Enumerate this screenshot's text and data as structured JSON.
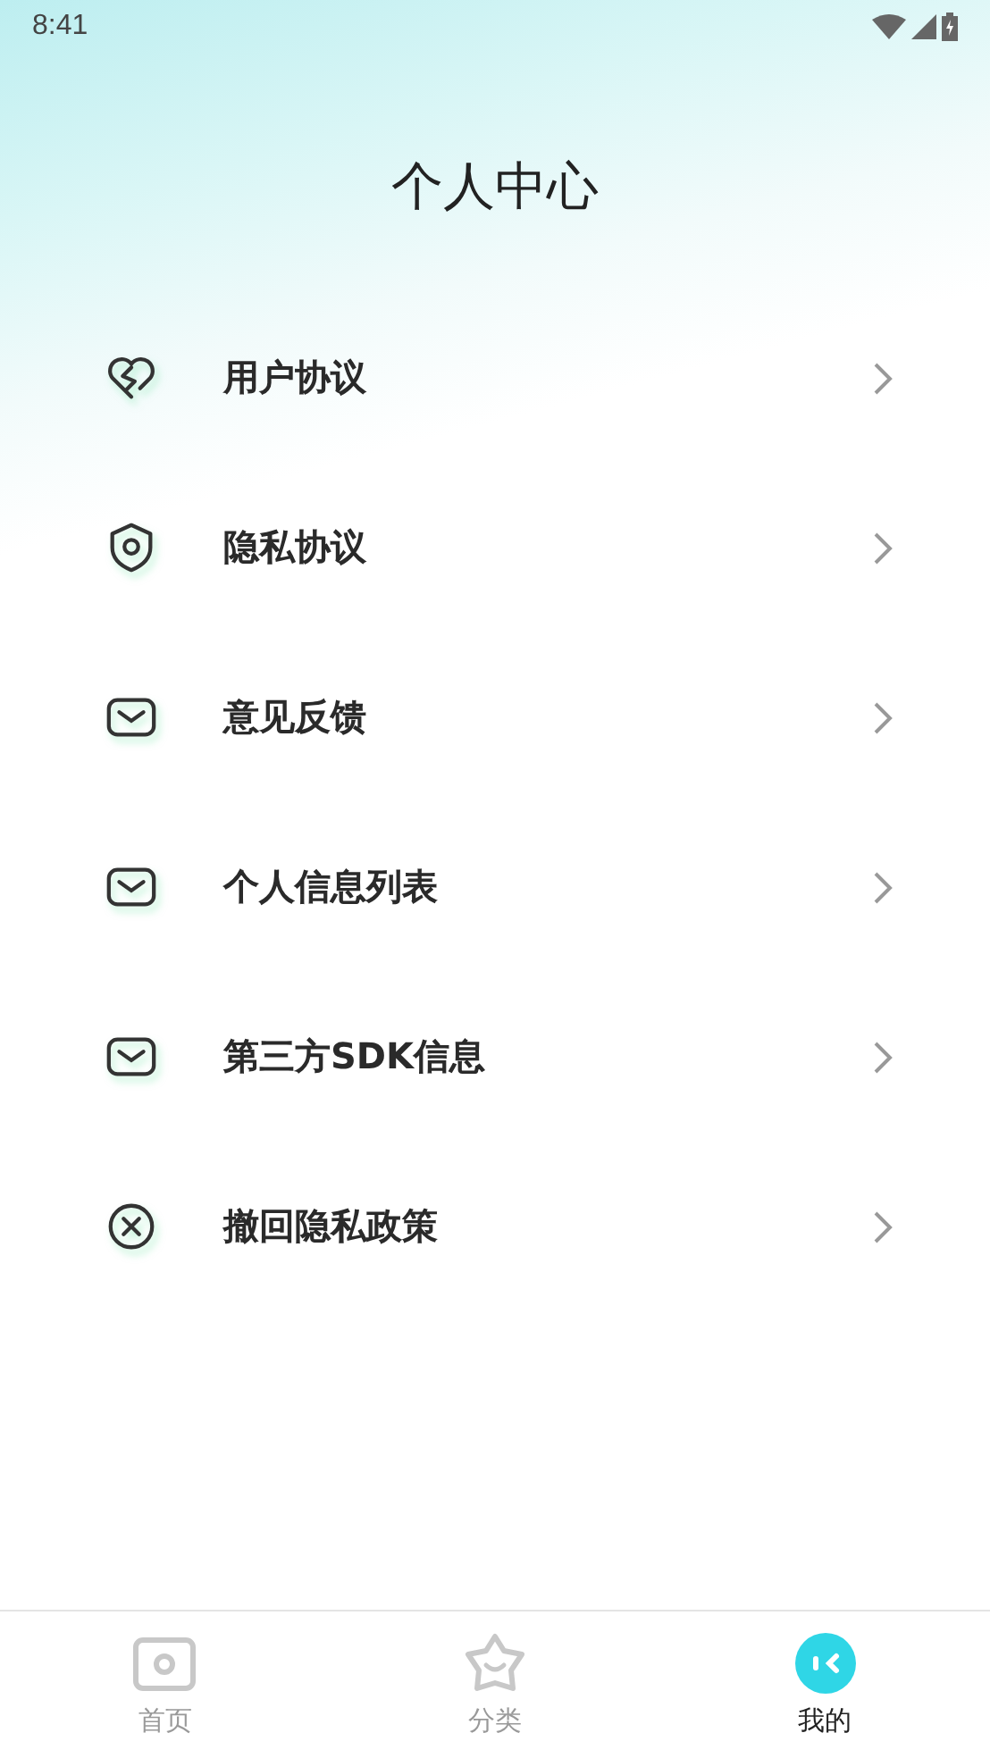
{
  "status_bar": {
    "time": "8:41"
  },
  "header": {
    "title": "个人中心"
  },
  "menu": [
    {
      "label": "用户协议",
      "kind": "heart"
    },
    {
      "label": "隐私协议",
      "kind": "shield"
    },
    {
      "label": "意见反馈",
      "kind": "mail"
    },
    {
      "label": "个人信息列表",
      "kind": "mail"
    },
    {
      "label": "第三方SDK信息",
      "kind": "mail"
    },
    {
      "label": "撤回隐私政策",
      "kind": "cancel"
    }
  ],
  "tab_bar": [
    {
      "label": "首页",
      "kind": "photo",
      "selected": false
    },
    {
      "label": "分类",
      "kind": "star",
      "selected": false
    },
    {
      "label": "我的",
      "kind": "face",
      "selected": true
    }
  ]
}
